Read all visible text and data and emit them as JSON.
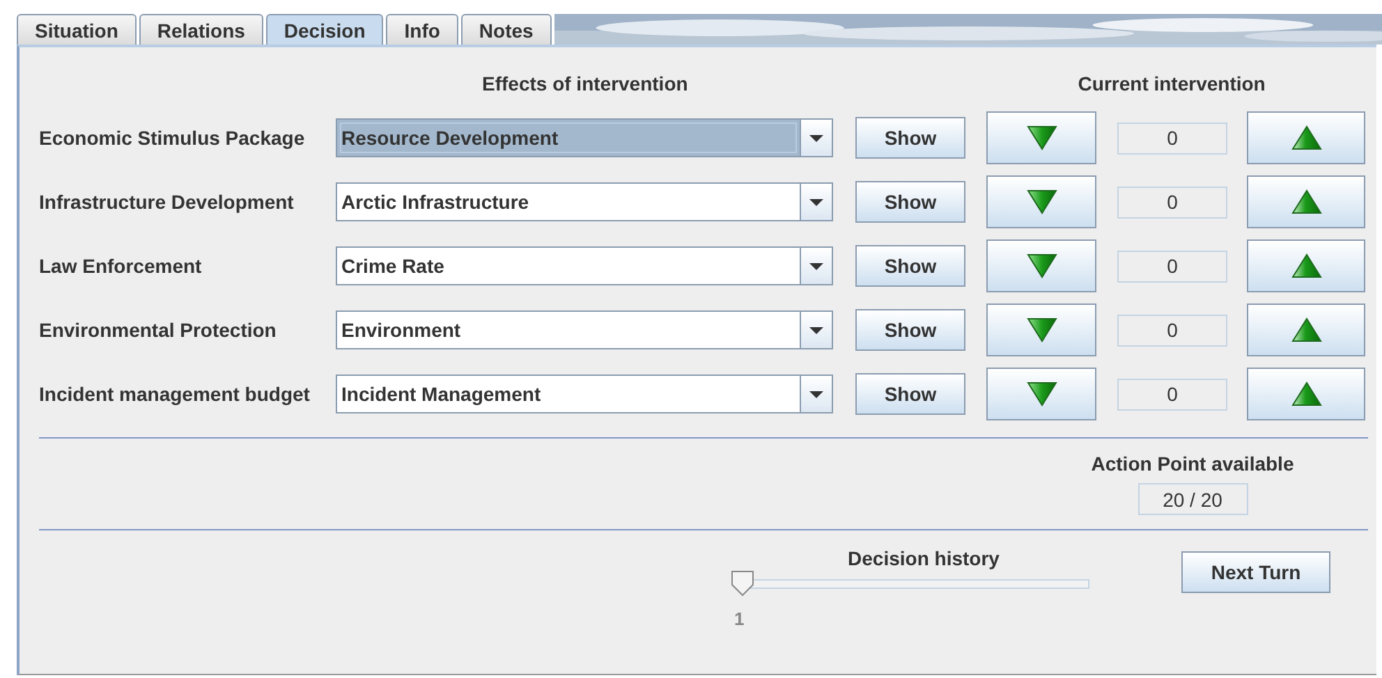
{
  "tabs": [
    {
      "label": "Situation",
      "selected": false
    },
    {
      "label": "Relations",
      "selected": false
    },
    {
      "label": "Decision",
      "selected": true
    },
    {
      "label": "Info",
      "selected": false
    },
    {
      "label": "Notes",
      "selected": false
    }
  ],
  "headers": {
    "effects": "Effects of intervention",
    "current": "Current intervention"
  },
  "rows": [
    {
      "label": "Economic Stimulus Package",
      "effect": "Resource Development",
      "focused": true,
      "show": "Show",
      "value": "0"
    },
    {
      "label": "Infrastructure Development",
      "effect": "Arctic Infrastructure",
      "focused": false,
      "show": "Show",
      "value": "0"
    },
    {
      "label": "Law Enforcement",
      "effect": "Crime Rate",
      "focused": false,
      "show": "Show",
      "value": "0"
    },
    {
      "label": "Environmental Protection",
      "effect": "Environment",
      "focused": false,
      "show": "Show",
      "value": "0"
    },
    {
      "label": "Incident management budget",
      "effect": "Incident Management",
      "focused": false,
      "show": "Show",
      "value": "0"
    }
  ],
  "action_points": {
    "label": "Action Point available",
    "value": "20 / 20"
  },
  "history": {
    "label": "Decision history",
    "level": 0,
    "tick": "1"
  },
  "next_button": "Next Turn"
}
